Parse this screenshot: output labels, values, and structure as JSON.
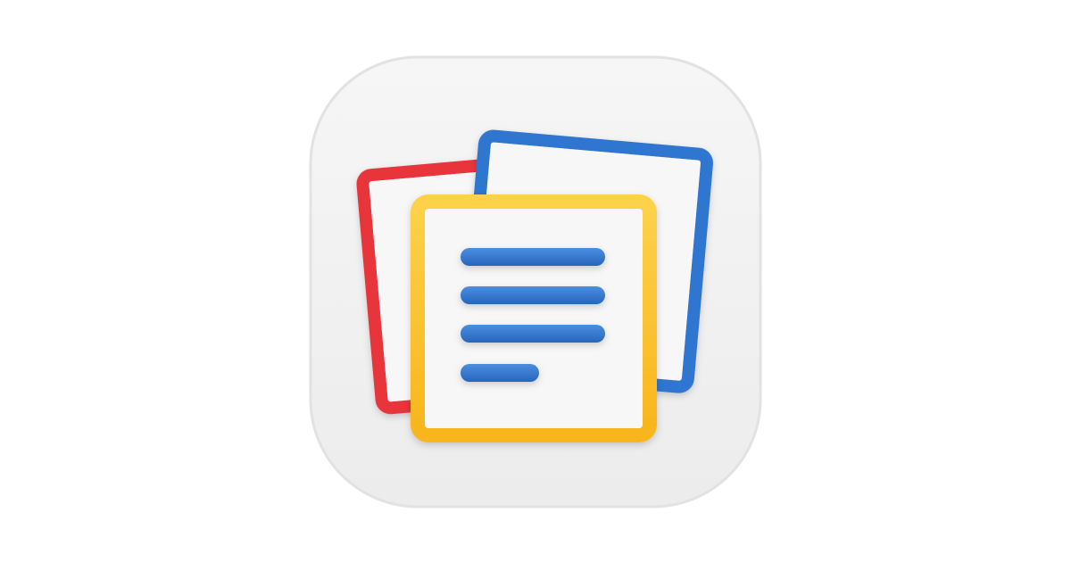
{
  "app_icon": {
    "icon": "notebook-notes-icon",
    "colors": {
      "tile_background": "#f1f1f1",
      "tile_border": "#e4e4e4",
      "back_card_red": "#e8343a",
      "middle_card_blue": "#2f76cf",
      "front_card_yellow": "#fbbf24",
      "card_fill": "#f7f7f7",
      "text_lines_blue": "#2f76cf"
    }
  }
}
